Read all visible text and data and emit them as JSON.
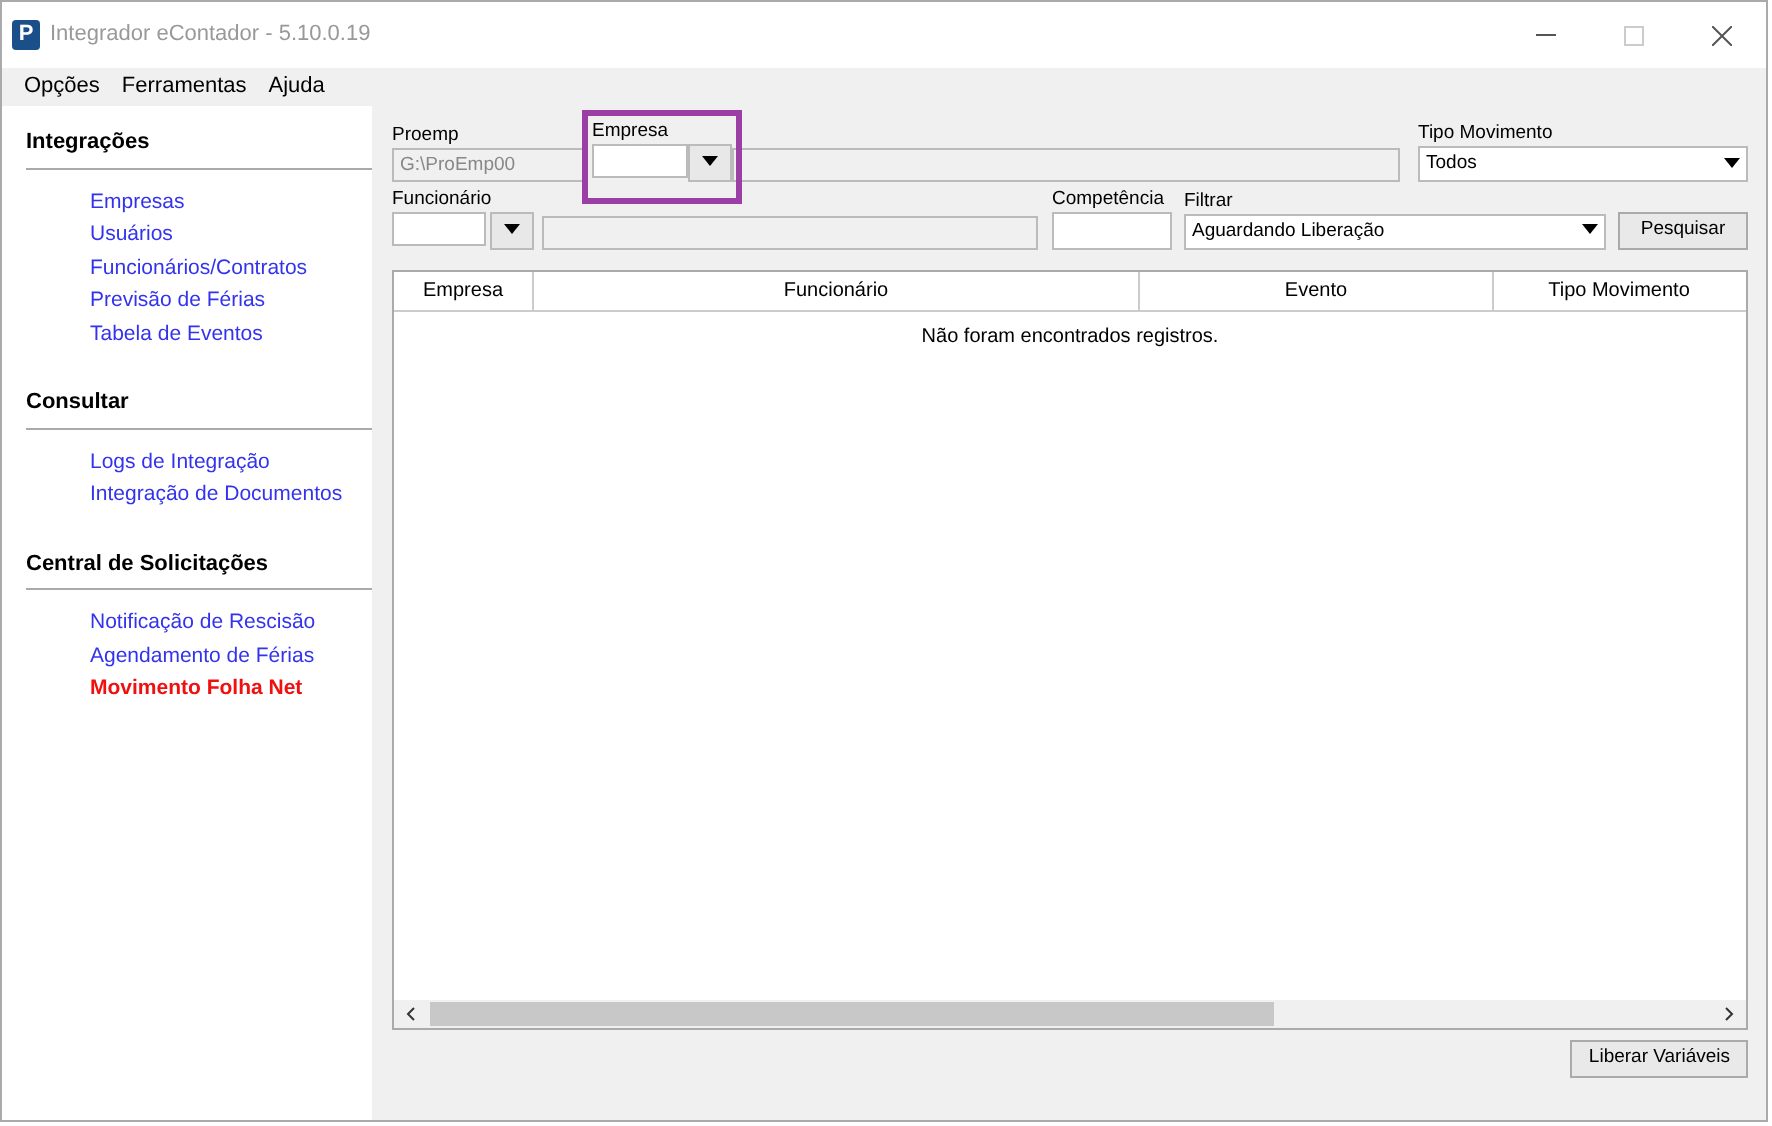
{
  "window": {
    "icon_letter": "P",
    "title": "Integrador eContador - 5.10.0.19"
  },
  "menu": [
    "Opções",
    "Ferramentas",
    "Ajuda"
  ],
  "sidebar": [
    {
      "title": "Integrações",
      "items": [
        {
          "label": "Empresas",
          "selected": false
        },
        {
          "label": "Usuários",
          "selected": false
        },
        {
          "label": "Funcionários/Contratos",
          "selected": false
        },
        {
          "label": "Previsão de Férias",
          "selected": false
        },
        {
          "label": "Tabela de Eventos",
          "selected": false
        }
      ]
    },
    {
      "title": "Consultar",
      "items": [
        {
          "label": "Logs de Integração",
          "selected": false
        },
        {
          "label": "Integração de Documentos",
          "selected": false
        }
      ]
    },
    {
      "title": "Central de Solicitações",
      "items": [
        {
          "label": "Notificação de Rescisão",
          "selected": false
        },
        {
          "label": "Agendamento de Férias",
          "selected": false
        },
        {
          "label": "Movimento Folha Net",
          "selected": true
        }
      ]
    }
  ],
  "form": {
    "proemp": {
      "label": "Proemp",
      "value": "G:\\ProEmp00",
      "disabled": true
    },
    "empresa": {
      "label": "Empresa",
      "highlighted": true
    },
    "tipo_movimento": {
      "label": "Tipo Movimento",
      "value": "Todos"
    },
    "funcionario": {
      "label": "Funcionário"
    },
    "competencia": {
      "label": "Competência"
    },
    "filtrar": {
      "label": "Filtrar",
      "value": "Aguardando Liberação"
    },
    "search_button": "Pesquisar"
  },
  "table": {
    "columns": [
      "Empresa",
      "Funcionário",
      "Evento",
      "Tipo Movimento"
    ],
    "empty_message": "Não foram encontrados registros."
  },
  "footer_button": "Liberar Variáveis"
}
